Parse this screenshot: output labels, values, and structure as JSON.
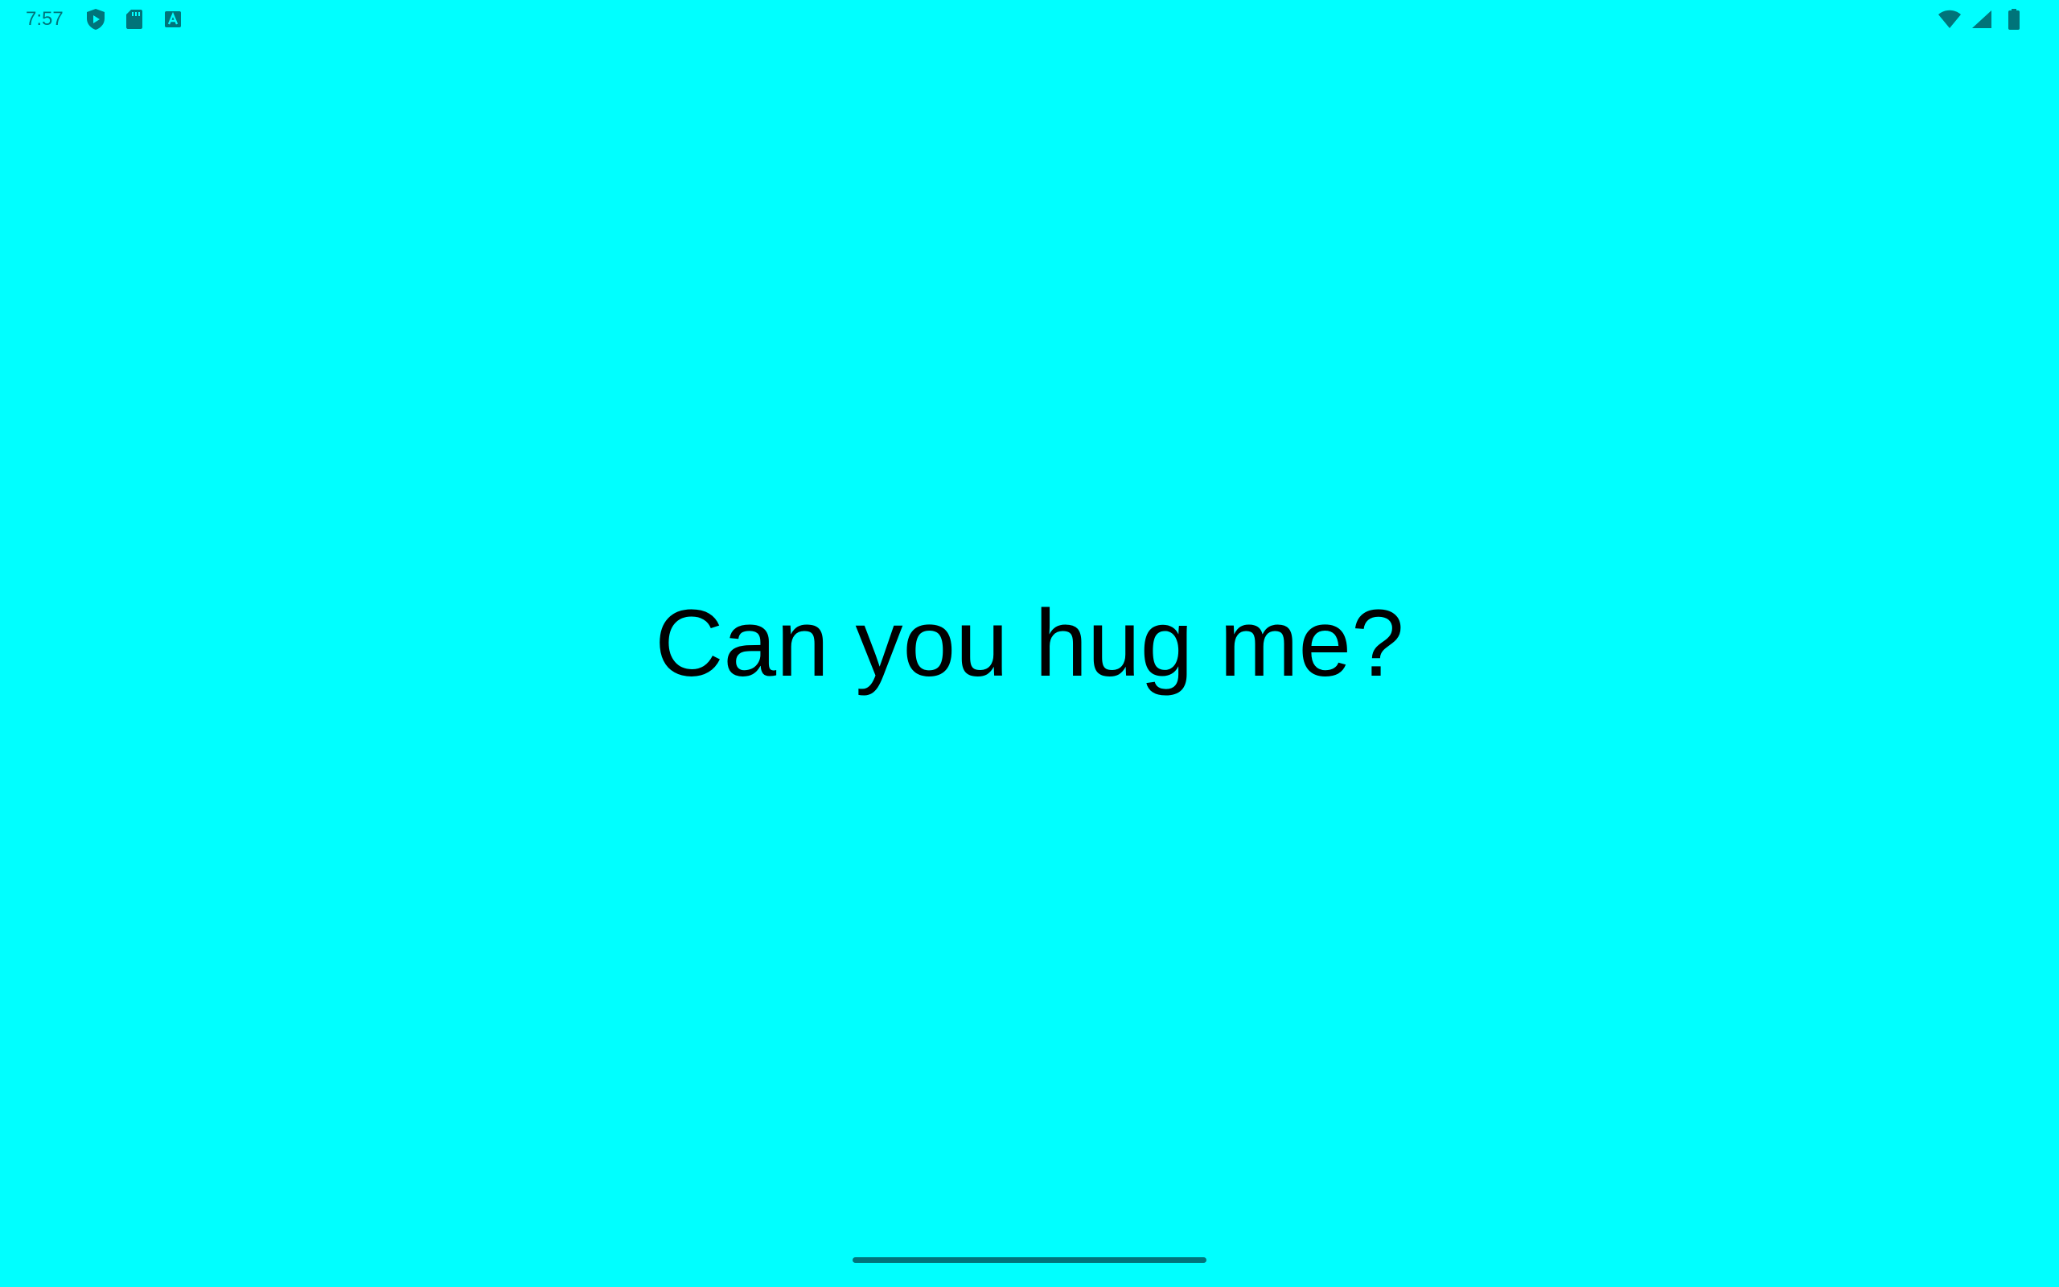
{
  "status_bar": {
    "time": "7:57",
    "left_icons": [
      "shield-play-icon",
      "sd-card-icon",
      "text-a-icon"
    ],
    "right_icons": [
      "wifi-icon",
      "cellular-signal-icon",
      "battery-icon"
    ],
    "icon_color": "#00747A"
  },
  "main": {
    "message": "Can you hug me?",
    "background_color": "#00FFFF",
    "text_color": "#000000"
  },
  "navigation": {
    "handle": "gesture-nav-handle"
  }
}
